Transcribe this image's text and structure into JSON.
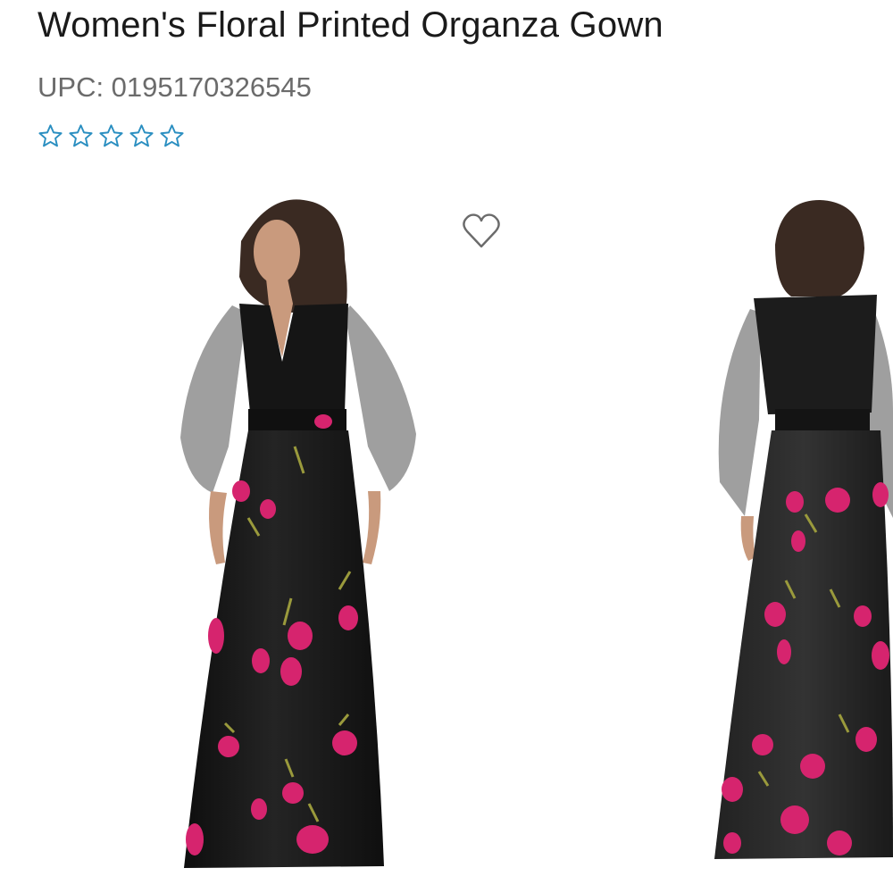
{
  "product": {
    "title": "Women's Floral Printed Organza Gown",
    "upc": "UPC: 0195170326545",
    "rating": {
      "stars_filled": 0,
      "stars_total": 5
    }
  },
  "gallery": {
    "images": [
      {
        "name": "front-view",
        "alt": "Women's Floral Printed Organza Gown - front"
      },
      {
        "name": "back-view",
        "alt": "Women's Floral Printed Organza Gown - back"
      }
    ],
    "favorite_icon": "heart-outline-icon"
  },
  "colors": {
    "title": "#1a1a1a",
    "upc": "#6b6b6b",
    "star_outline": "#2b8fc1",
    "gown": "#161616",
    "floral": "#d6246e"
  }
}
